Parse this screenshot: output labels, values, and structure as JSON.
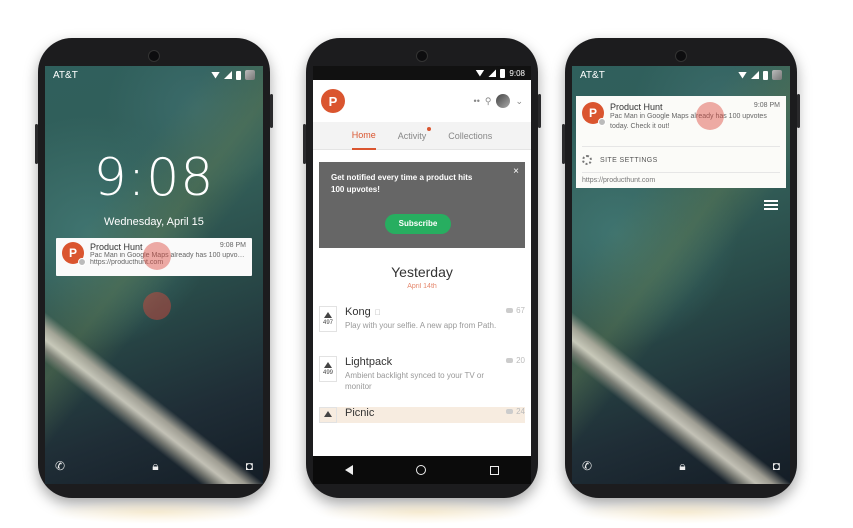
{
  "phone_left": {
    "carrier": "AT&T",
    "time": "9:08",
    "date": "Wednesday, April 15",
    "notification": {
      "app": "Product Hunt",
      "time": "9:08 PM",
      "text": "Pac Man in Google Maps already has 100 upvote...",
      "url": "https://producthunt.com"
    },
    "icons": [
      "phone-icon",
      "lock-icon",
      "camera-icon"
    ]
  },
  "phone_middle": {
    "status_time": "9:08",
    "logo_letter": "P",
    "tabs": [
      {
        "label": "Home"
      },
      {
        "label": "Activity"
      },
      {
        "label": "Collections"
      }
    ],
    "promo": {
      "text": "Get notified every time a product hits 100 upvotes!",
      "button": "Subscribe",
      "close": "×"
    },
    "day": {
      "title": "Yesterday",
      "subtitle": "April 14th"
    },
    "posts": [
      {
        "votes": "497",
        "title": "Kong",
        "desc": "Play with your selfie. A new app from Path.",
        "comments": "67"
      },
      {
        "votes": "499",
        "title": "Lightpack",
        "desc": "Ambient backlight synced to your TV or monitor",
        "comments": "20"
      },
      {
        "votes": "",
        "title": "Picnic",
        "desc": "",
        "comments": "24"
      }
    ]
  },
  "phone_right": {
    "carrier": "AT&T",
    "notification": {
      "app": "Product Hunt",
      "time": "9:08 PM",
      "text": "Pac Man in Google Maps already has 100 upvotes today. Check it out!",
      "settings": "SITE SETTINGS",
      "url": "https://producthunt.com"
    }
  },
  "logo_letter": "P"
}
